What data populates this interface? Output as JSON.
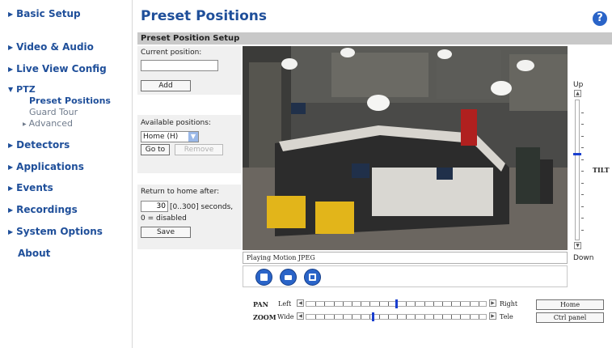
{
  "sidebar": {
    "items": [
      {
        "label": "Basic Setup"
      },
      {
        "label": "Video & Audio"
      },
      {
        "label": "Live View Config"
      },
      {
        "label": "PTZ"
      },
      {
        "label": "Detectors"
      },
      {
        "label": "Applications"
      },
      {
        "label": "Events"
      },
      {
        "label": "Recordings"
      },
      {
        "label": "System Options"
      },
      {
        "label": "About"
      }
    ],
    "ptz_sub": {
      "preset_positions": "Preset Positions",
      "guard_tour": "Guard Tour",
      "advanced": "Advanced"
    }
  },
  "header": {
    "title": "Preset Positions",
    "help_icon": "question-mark-icon",
    "section": "Preset Position Setup"
  },
  "form": {
    "current_position_label": "Current position:",
    "current_position_value": "",
    "add_label": "Add",
    "available_positions_label": "Available positions:",
    "available_selected": "Home (H)",
    "goto_label": "Go to",
    "remove_label": "Remove",
    "return_home_label": "Return to home after:",
    "return_home_value": "30",
    "return_home_range": "[0..300] seconds,",
    "return_home_note": "0 = disabled",
    "save_label": "Save"
  },
  "video": {
    "status": "Playing Motion JPEG",
    "buttons": [
      "stop-icon",
      "snapshot-icon",
      "fullscreen-icon"
    ]
  },
  "tilt": {
    "up_label": "Up",
    "down_label": "Down",
    "label": "TILT",
    "level": 0.38
  },
  "pan": {
    "label": "PAN",
    "left_label": "Left",
    "right_label": "Right",
    "level": 0.5
  },
  "zoom": {
    "label": "ZOOM",
    "wide_label": "Wide",
    "tele_label": "Tele",
    "level": 0.37
  },
  "side_buttons": {
    "home_label": "Home",
    "ctrl_panel_label": "Ctrl panel"
  },
  "colors": {
    "link": "#1f4f9a",
    "accent": "#2a64c8",
    "slider_thumb": "#1a3fcf",
    "section_bar": "#c8c8c8"
  }
}
